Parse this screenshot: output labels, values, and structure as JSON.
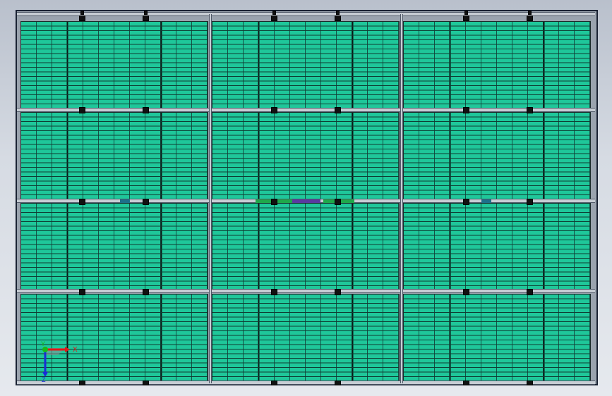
{
  "view": {
    "background": "#cfd5dd",
    "panel_color": "#1fc79a",
    "frame_color": "#1a2233",
    "grid_rows": 4,
    "grid_cols": 3
  },
  "triad": {
    "x_label": "X",
    "y_label": "Y",
    "z_label": "Z",
    "x_color": "#e01818",
    "y_color": "#18b818",
    "z_color": "#1a2ad8"
  }
}
